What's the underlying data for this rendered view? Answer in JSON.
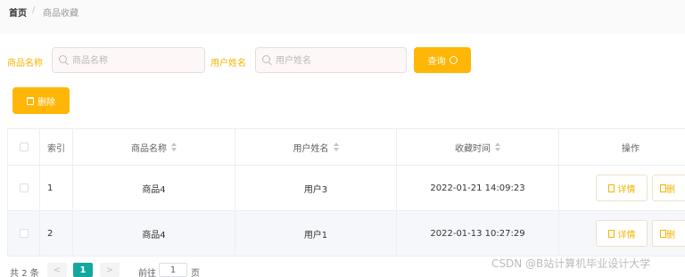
{
  "breadcrumb": {
    "home": "首页",
    "separator": "/",
    "current": "商品收藏"
  },
  "search": {
    "product_label": "商品名称",
    "product_placeholder": "商品名称",
    "user_label": "用户姓名",
    "user_placeholder": "用户姓名",
    "query_button": "查询"
  },
  "actions": {
    "delete_button": "删除"
  },
  "table": {
    "headers": {
      "index": "索引",
      "product": "商品名称",
      "user": "用户姓名",
      "time": "收藏时间",
      "ops": "操作"
    },
    "rows": [
      {
        "index": "1",
        "product": "商品4",
        "user": "用户3",
        "time": "2022-01-21 14:09:23",
        "detail": "详情",
        "more": "删"
      },
      {
        "index": "2",
        "product": "商品4",
        "user": "用户1",
        "time": "2022-01-13 10:27:29",
        "detail": "详情",
        "more": "删"
      }
    ]
  },
  "pagination": {
    "total": "共 2 条",
    "prev": "<",
    "current": "1",
    "next": ">",
    "goto": "前往",
    "goto_value": "1",
    "page_suffix": "页"
  },
  "watermark": "CSDN @B站计算机毕业设计大学",
  "colors": {
    "accent": "#ffb606",
    "pager_active": "#13a89e",
    "label": "#f5b400"
  }
}
